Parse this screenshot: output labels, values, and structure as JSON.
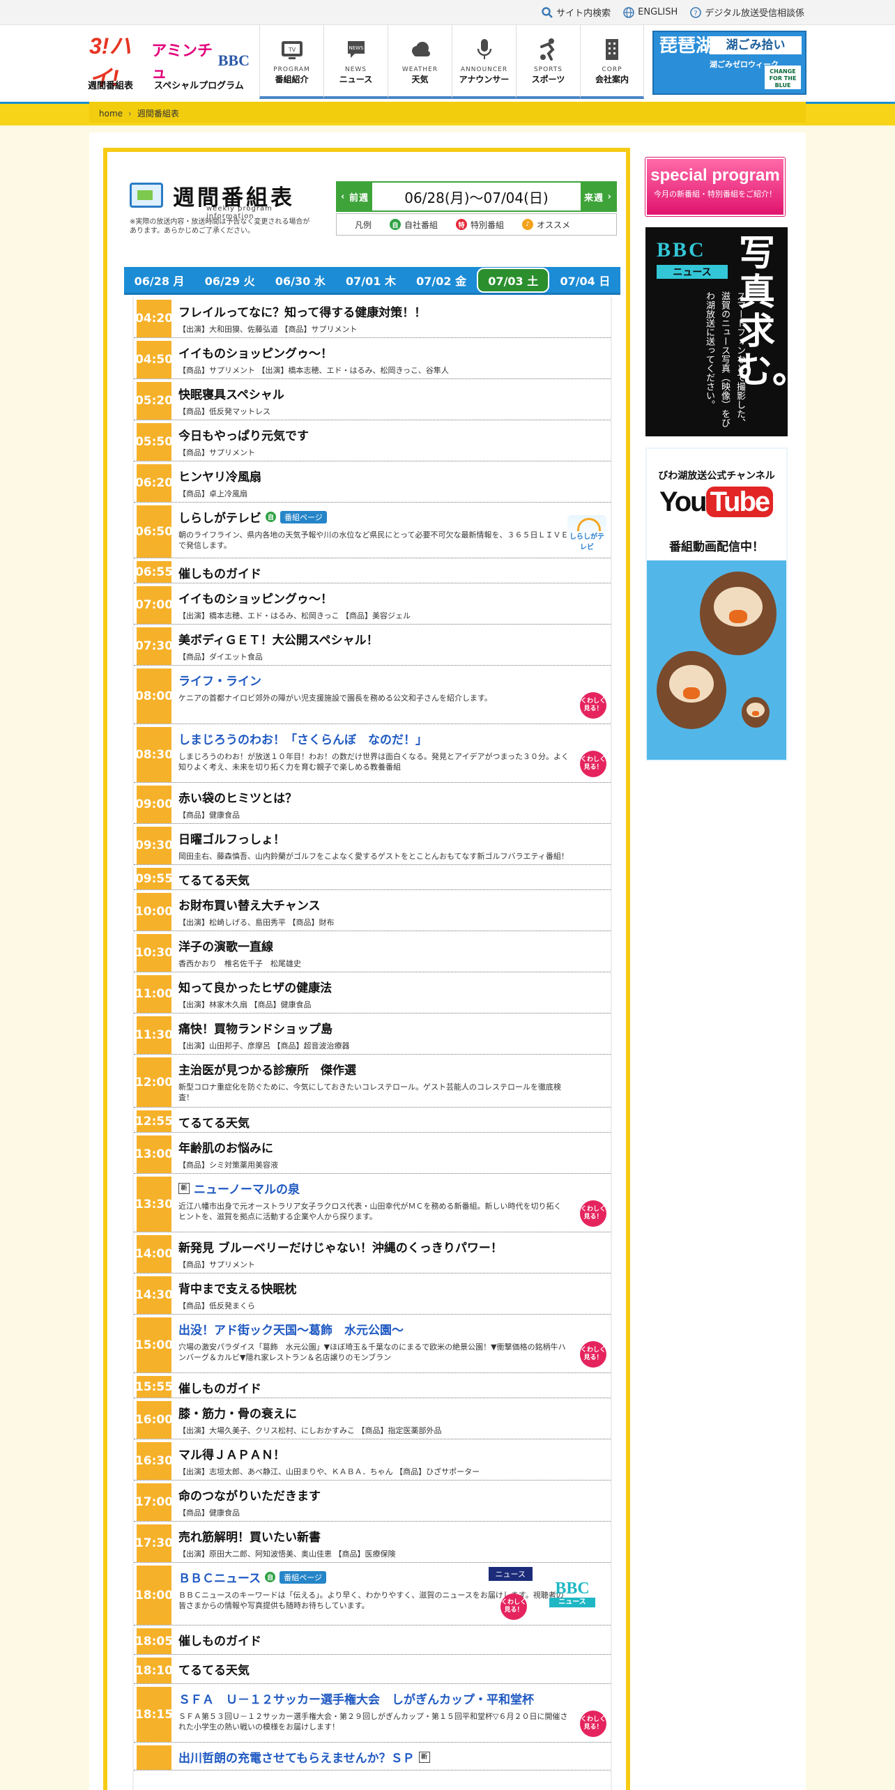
{
  "utility": {
    "search": "サイト内検索",
    "english": "ENGLISH",
    "consult": "デジタル放送受信相談係"
  },
  "logo": {
    "part1": "3!ハイ!",
    "part2": "アミンチュ",
    "part3": "BBC"
  },
  "subnav": [
    "週間番組表",
    "スペシャルプログラム"
  ],
  "gnav": [
    {
      "en": "PROGRAM",
      "ja": "番組紹介",
      "icon": "tv-icon"
    },
    {
      "en": "NEWS",
      "ja": "ニュース",
      "icon": "news-icon"
    },
    {
      "en": "WEATHER",
      "ja": "天気",
      "icon": "cloud-icon"
    },
    {
      "en": "ANNOUNCER",
      "ja": "アナウンサー",
      "icon": "microphone-icon"
    },
    {
      "en": "SPORTS",
      "ja": "スポーツ",
      "icon": "sports-icon"
    },
    {
      "en": "CORP",
      "ja": "会社案内",
      "icon": "building-icon"
    }
  ],
  "banner": {
    "title": "琵琶湖一周",
    "sub": "湖ごみ拾い",
    "caption": "湖ごみゼロウィーク",
    "badge": "CHANGE FOR THE BLUE"
  },
  "breadcrumb": [
    "home",
    "週間番組表"
  ],
  "weekly": {
    "title": "週間番組表",
    "subtitle": "weekly program information",
    "note": "※実際の放送内容・放送時間は予告なく変更される場合があります。あらかじめご了承ください。"
  },
  "weeknav": {
    "prev": "前週",
    "range": "06/28(月)～07/04(日)",
    "next": "来週"
  },
  "legend": {
    "label": "凡例",
    "self": "自社番組",
    "special": "特別番組",
    "recommend": "オススメ"
  },
  "days": [
    {
      "label": "06/28 月",
      "selected": false
    },
    {
      "label": "06/29 火",
      "selected": false
    },
    {
      "label": "06/30 水",
      "selected": false
    },
    {
      "label": "07/01 木",
      "selected": false
    },
    {
      "label": "07/02 金",
      "selected": false
    },
    {
      "label": "07/03 土",
      "selected": true
    },
    {
      "label": "07/04 日",
      "selected": false
    }
  ],
  "programs": [
    {
      "time": "04:20",
      "title": "フレイルってなに？知って得する健康対策！！",
      "desc": "【出演】大和田獏、佐藤弘道 【商品】サプリメント",
      "h": 59
    },
    {
      "time": "04:50",
      "title": "イイものショッピングゥ～！",
      "desc": "【商品】サプリメント 【出演】橋本志穂、エド・はるみ、松岡きっこ、谷隼人",
      "h": 59
    },
    {
      "time": "05:20",
      "title": "快眠寝具スペシャル",
      "desc": "【商品】低反発マットレス",
      "h": 59
    },
    {
      "time": "05:50",
      "title": "今日もやっぱり元気です",
      "desc": "【商品】サプリメント",
      "h": 59
    },
    {
      "time": "06:20",
      "title": "ヒンヤリ冷風扇",
      "desc": "【商品】卓上冷風扇",
      "h": 59
    },
    {
      "time": "06:50",
      "title": "しらしがテレビ",
      "desc": "朝のライフライン、県内各地の天気予報や川の水位など県民にとって必要不可欠な最新情報を、３６５日ＬＩＶＥで発信します。",
      "h": 80,
      "own": true,
      "page": "番組ページ",
      "shirashiga": "しらしがテレビ"
    },
    {
      "time": "06:55",
      "title": "催しものガイド",
      "desc": "",
      "h": 36
    },
    {
      "time": "07:00",
      "title": "イイものショッピングゥ～！",
      "desc": "【出演】橋本志穂、エド・はるみ、松岡きっこ 【商品】美容ジェル",
      "h": 59
    },
    {
      "time": "07:30",
      "title": "美ボディＧＥＴ！大公開スペシャル！",
      "desc": "【商品】ダイエット食品",
      "h": 59
    },
    {
      "time": "08:00",
      "title": "ライフ・ライン",
      "desc": "ケニアの首都ナイロビ郊外の障がい児支援施設で園長を務める公文和子さんを紹介します。",
      "h": 84,
      "blue": true,
      "more": "くわしく見る！"
    },
    {
      "time": "08:30",
      "title": "しまじろうのわお！「さくらんぼ　なのだ！」",
      "desc": "しまじろうのわお！が放送１０年目！わお！の数だけ世界は面白くなる。発見とアイデアがつまった３０分。よく知りよく考え、未来を切り拓く力を育む親子で楽しめる教養番組",
      "h": 84,
      "blue": true,
      "more": "くわしく見る！"
    },
    {
      "time": "09:00",
      "title": "赤い袋のヒミツとは？",
      "desc": "【商品】健康食品",
      "h": 59
    },
    {
      "time": "09:30",
      "title": "日曜ゴルフっしょ！",
      "desc": "岡田圭右、藤森慎吾、山内鈴蘭がゴルフをこよなく愛するゲストをとことんおもてなす新ゴルフバラエティ番組！",
      "h": 59
    },
    {
      "time": "09:55",
      "title": "てるてる天気",
      "desc": "",
      "h": 36
    },
    {
      "time": "10:00",
      "title": "お財布買い替え大チャンス",
      "desc": "【出演】松崎しげる、島田秀平 【商品】財布",
      "h": 59
    },
    {
      "time": "10:30",
      "title": "洋子の演歌一直線",
      "desc": "香西かおり　椎名佐千子　松尾雄史",
      "h": 59
    },
    {
      "time": "11:00",
      "title": "知って良かったヒザの健康法",
      "desc": "【出演】林家木久扇 【商品】健康食品",
      "h": 59
    },
    {
      "time": "11:30",
      "title": "痛快！買物ランドショップ島",
      "desc": "【出演】山田邦子、彦摩呂 【商品】超音波治療器",
      "h": 59
    },
    {
      "time": "12:00",
      "title": "主治医が見つかる診療所　傑作選",
      "desc": "新型コロナ重症化を防ぐために、今気にしておきたいコレステロール。ゲスト芸能人のコレステロールを徹底検査！",
      "h": 76
    },
    {
      "time": "12:55",
      "title": "てるてる天気",
      "desc": "",
      "h": 36
    },
    {
      "time": "13:00",
      "title": "年齢肌のお悩みに",
      "desc": "【商品】シミ対策薬用美容液",
      "h": 59
    },
    {
      "time": "13:30",
      "title": "ニューノーマルの泉",
      "desc": "近江八幡市出身で元オーストラリア女子ラクロス代表・山田幸代がＭＣを務める新番組。新しい時代を切り拓くヒントを、滋賀を拠点に活動する企業や人から探ります。",
      "h": 84,
      "blue": true,
      "news": true,
      "more": "くわしく見る！"
    },
    {
      "time": "14:00",
      "title": "新発見 ブルーベリーだけじゃない！沖縄のくっきりパワー！",
      "desc": "【商品】サプリメント",
      "h": 59
    },
    {
      "time": "14:30",
      "title": "背中まで支える快眠枕",
      "desc": "【商品】低反発まくら",
      "h": 59
    },
    {
      "time": "15:00",
      "title": "出没！アド街ック天国～葛飾　水元公園～",
      "desc": "穴場の激安パラダイス「葛飾　水元公園」▼ほぼ埼玉＆千葉なのにまるで欧米の絶景公園！▼衝撃価格の銘柄牛ハンバーグ＆カルビ▼隠れ家レストラン＆名店譲りのモンブラン",
      "h": 84,
      "blue": true,
      "more": "くわしく見る！"
    },
    {
      "time": "15:55",
      "title": "催しものガイド",
      "desc": "",
      "h": 36
    },
    {
      "time": "16:00",
      "title": "膝・筋力・骨の衰えに",
      "desc": "【出演】大場久美子、クリス松村、にしおかすみこ 【商品】指定医薬部外品",
      "h": 59
    },
    {
      "time": "16:30",
      "title": "マル得ＪＡＰＡＮ！",
      "desc": "【出演】志垣太郎、あべ静江、山田まりや、ＫＡＢＡ．ちゃん 【商品】ひざサポーター",
      "h": 59
    },
    {
      "time": "17:00",
      "title": "命のつながりいただきます",
      "desc": "【商品】健康食品",
      "h": 59
    },
    {
      "time": "17:30",
      "title": "売れ筋解明！買いたい新書",
      "desc": "【出演】原田大二郎、阿知波悟美、奥山佳恵 【商品】医療保険",
      "h": 59
    },
    {
      "time": "18:00",
      "title": "ＢＢＣニュース",
      "desc": "ＢＢＣニュースのキーワードは「伝える」。より早く、わかりやすく、滋賀のニュースをお届けします。視聴者の皆さまからの情報や写真提供も随時お待ちしています。",
      "h": 90,
      "blue": true,
      "own": true,
      "page": "番組ページ",
      "badge": "ニュース",
      "bbc": "BBC",
      "bbcsub": "ニュース",
      "more": "くわしく見る！"
    },
    {
      "time": "18:05",
      "title": "催しものガイド",
      "desc": "",
      "h": 42
    },
    {
      "time": "18:10",
      "title": "てるてる天気",
      "desc": "",
      "h": 42
    },
    {
      "time": "18:15",
      "title": "ＳＦＡ　Ｕ－１２サッカー選手権大会　しがぎんカップ・平和堂杯",
      "desc": "ＳＦＡ第５３回Ｕ－１２サッカー選手権大会・第２９回しがぎんカップ・第１５回平和堂杯▽６月２０日に開催された小学生の熱い戦いの模様をお届けします！",
      "h": 84,
      "blue": true,
      "more": "くわしく見る！"
    },
    {
      "time": "",
      "title": "出川哲朗の充電させてもらえませんか？ＳＰ",
      "desc": "",
      "h": 40,
      "blue": true,
      "news2": true
    }
  ],
  "sidebar": {
    "special": {
      "title": "special program",
      "sub": "今月の新番組・特別番組をご紹介！"
    },
    "bbc": {
      "logo": "BBC",
      "tag": "ニュース",
      "big": "写真求む。",
      "text": "スマートフォンなどで撮影した、滋賀のニュース写真（映像）をびわ湖放送に送ってください。"
    },
    "youtube": {
      "top": "びわ湖放送公式チャンネル",
      "logo1": "You",
      "logo2": "Tube",
      "bottom": "番組動画配信中！"
    }
  },
  "colors": {
    "accent": "#f6b12a",
    "blue": "#1c8cd6",
    "yellow": "#f5cb16",
    "green": "#3ea43a"
  }
}
